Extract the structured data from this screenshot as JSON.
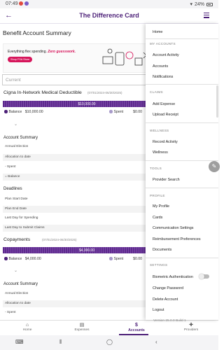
{
  "status": {
    "time": "07:49",
    "battery": "24%"
  },
  "appbar": {
    "back": "←",
    "title": "The Difference Card"
  },
  "main": {
    "page_title": "Benefit Account Summary",
    "banner": {
      "text_plain": "Everything flex spending. ",
      "text_accent": "Zero guesswork.",
      "button": "Shop FSA Store"
    },
    "current_placeholder": "Current",
    "cards": [
      {
        "title": "Cigna In-Network Medical Deductible",
        "dates": "(07/01/2024-06/30/2025)",
        "bar_value": "$10,000.00",
        "balance_label": "Balance",
        "balance_value": "$10,000.00",
        "spent_label": "Spent",
        "spent_value": "$0.00",
        "chevron": "⌄",
        "summary_title": "Account Summary",
        "rows": [
          "Annual Election",
          "Allocation to date",
          "- Spent",
          "= Balance"
        ],
        "deadlines_title": "Deadlines",
        "deadline_rows": [
          "Plan Start Date",
          "Plan End Date",
          "Last Day for Spending",
          "Last Day to Submit Claims"
        ]
      },
      {
        "title": "Copayments",
        "dates": "(07/01/2024-06/30/2025)",
        "bar_value": "$4,000.00",
        "balance_label": "Balance",
        "balance_value": "$4,000.00",
        "spent_label": "Spent",
        "spent_value": "$0.00",
        "chevron": "⌄",
        "summary_title": "Account Summary",
        "rows": [
          "Annual Election",
          "Allocation to date",
          "- Spent"
        ]
      }
    ]
  },
  "bottom_nav": [
    {
      "label": "Home",
      "icon": "⌂"
    },
    {
      "label": "Expenses",
      "icon": "▤"
    },
    {
      "label": "Accounts",
      "icon": "$"
    },
    {
      "label": "Providers",
      "icon": "✚"
    }
  ],
  "drawer": {
    "home": "Home",
    "my_accounts_head": "MY ACCOUNTS",
    "account_activity": "Account Activity",
    "accounts": "Accounts",
    "notifications": "Notifications",
    "claims_head": "CLAIMS",
    "add_expense": "Add Expense",
    "upload_receipt": "Upload Receipt",
    "wellness_head": "WELLNESS",
    "record_activity": "Record Activity",
    "wellness": "Wellness",
    "tools_head": "TOOLS",
    "provider_search": "Provider Search",
    "profile_head": "PROFILE",
    "my_profile": "My Profile",
    "cards": "Cards",
    "communication_settings": "Communication Settings",
    "reimbursement_preferences": "Reimbursement Preferences",
    "documents": "Documents",
    "settings_head": "SETTINGS",
    "biometric": "Biometric Authentication",
    "change_password": "Change Password",
    "delete_account": "Delete Account",
    "logout": "Logout",
    "version": "Version 25.0.0 Build 1"
  },
  "colors": {
    "brand": "#4b1f77",
    "accent": "#d6165b"
  },
  "icons": [
    "back-arrow-icon",
    "hamburger-menu-icon",
    "pencil-icon",
    "chevron-down-icon"
  ]
}
